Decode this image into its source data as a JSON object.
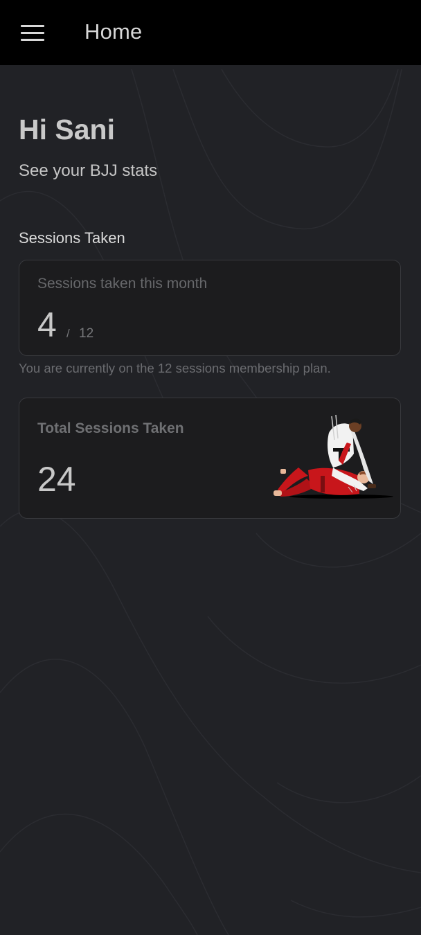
{
  "app_bar": {
    "title": "Home",
    "menu_icon": "hamburger-menu-icon"
  },
  "header": {
    "greeting": "Hi Sani",
    "subtitle": "See your BJJ stats"
  },
  "sessions": {
    "section_title": "Sessions Taken",
    "month_card": {
      "label": "Sessions taken this month",
      "taken": "4",
      "separator": "/",
      "limit": "12"
    },
    "plan_note": "You are currently on the 12 sessions membership plan.",
    "total_card": {
      "label": "Total Sessions Taken",
      "total": "24",
      "illustration": "bjj-grappling-illustration"
    }
  },
  "colors": {
    "background": "#212226",
    "app_bar": "#000000",
    "card": "#1c1c1e",
    "gi_red": "#c8161b",
    "gi_white": "#f2f2f2"
  }
}
